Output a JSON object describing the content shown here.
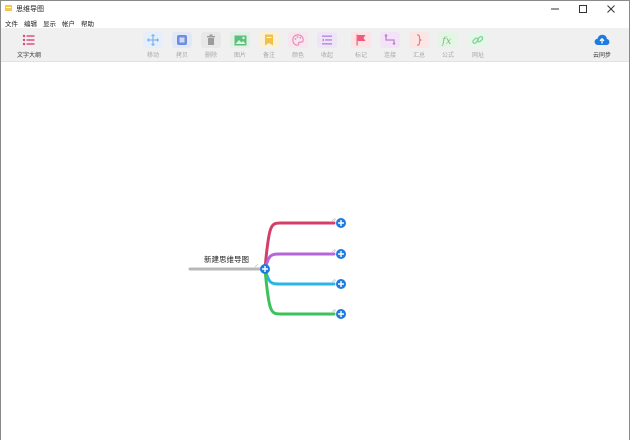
{
  "window": {
    "title": "思维导图"
  },
  "menu": {
    "items": [
      "文件",
      "编辑",
      "显示",
      "帐户",
      "帮助"
    ]
  },
  "toolbar": {
    "outline_label": "文字大纲",
    "tools": [
      {
        "name": "move",
        "label": "移动",
        "icon": "move-icon",
        "color": "#7fb4ee"
      },
      {
        "name": "copy",
        "label": "拷贝",
        "icon": "copy-icon",
        "color": "#6c8ede"
      },
      {
        "name": "delete",
        "label": "删除",
        "icon": "trash-icon",
        "color": "#9c9c9c"
      },
      {
        "name": "image",
        "label": "图片",
        "icon": "image-icon",
        "color": "#5dbf7c"
      },
      {
        "name": "note",
        "label": "备注",
        "icon": "note-icon",
        "color": "#f0c24c"
      },
      {
        "name": "color",
        "label": "颜色",
        "icon": "palette-icon",
        "color": "#e48ab8"
      },
      {
        "name": "collapse",
        "label": "收起",
        "icon": "collapse-icon",
        "color": "#b37fe0"
      },
      {
        "name": "mark",
        "label": "标记",
        "icon": "flag-icon",
        "color": "#ef5b7a"
      },
      {
        "name": "connect",
        "label": "连接",
        "icon": "connect-icon",
        "color": "#c779d6"
      },
      {
        "name": "summary",
        "label": "汇总",
        "icon": "brace-icon",
        "color": "#ef7a7a"
      },
      {
        "name": "formula",
        "label": "公式",
        "icon": "formula-icon",
        "color": "#6cc66c"
      },
      {
        "name": "url",
        "label": "网址",
        "icon": "link-icon",
        "color": "#7bd38f"
      }
    ],
    "cloud_label": "云同步",
    "cloud_color": "#1e7be0"
  },
  "mindmap": {
    "root_label": "新建思维导图",
    "root_line_color": "#b8b8b8",
    "node_button_color": "#1e7be0",
    "branch_colors": [
      "#d43f6a",
      "#b665d8",
      "#29b5e8",
      "#3cc25a"
    ]
  }
}
